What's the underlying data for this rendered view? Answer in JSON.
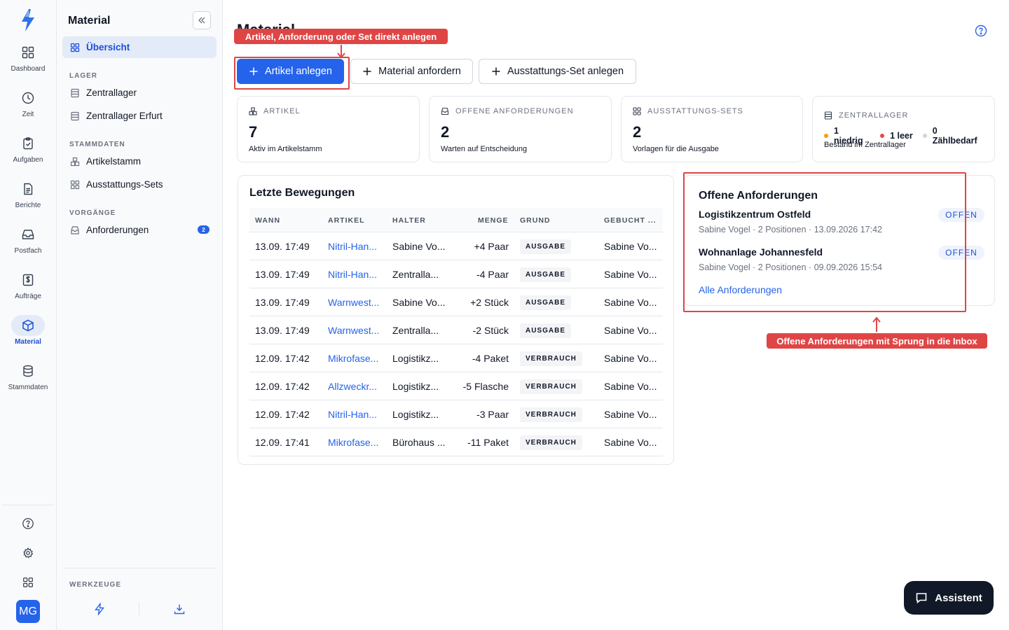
{
  "rail": {
    "items": [
      {
        "label": "Dashboard",
        "icon": "dashboard-icon"
      },
      {
        "label": "Zeit",
        "icon": "clock-icon"
      },
      {
        "label": "Aufgaben",
        "icon": "clipboard-icon"
      },
      {
        "label": "Berichte",
        "icon": "report-icon"
      },
      {
        "label": "Postfach",
        "icon": "inbox-icon"
      },
      {
        "label": "Aufträge",
        "icon": "dollar-document-icon"
      },
      {
        "label": "Material",
        "icon": "box-icon"
      },
      {
        "label": "Stammdaten",
        "icon": "database-icon"
      }
    ],
    "active": "Material",
    "avatar": "MG"
  },
  "nav": {
    "title": "Material",
    "overview": "Übersicht",
    "sections": {
      "lager": "LAGER",
      "stammdaten": "STAMMDATEN",
      "vorgaenge": "VORGÄNGE",
      "werkzeuge": "WERKZEUGE"
    },
    "lager_items": [
      "Zentrallager",
      "Zentrallager Erfurt"
    ],
    "stammdaten_items": [
      "Artikelstamm",
      "Ausstattungs-Sets"
    ],
    "vorgaenge_items": [
      {
        "label": "Anforderungen",
        "badge": "2"
      }
    ]
  },
  "main": {
    "title": "Material",
    "actions": {
      "create_article": "Artikel anlegen",
      "request_material": "Material anfordern",
      "create_set": "Ausstattungs-Set anlegen"
    },
    "kpis": [
      {
        "label": "ARTIKEL",
        "value": "7",
        "sub": "Aktiv im Artikelstamm"
      },
      {
        "label": "OFFENE ANFORDERUNGEN",
        "value": "2",
        "sub": "Warten auf Entscheidung"
      },
      {
        "label": "AUSSTATTUNGS-SETS",
        "value": "2",
        "sub": "Vorlagen für die Ausgabe"
      }
    ],
    "stock": {
      "label": "ZENTRALLAGER",
      "low": "1 niedrig",
      "empty": "1 leer",
      "count": "0 Zählbedarf",
      "sub": "Bestand im Zentrallager"
    },
    "movements": {
      "title": "Letzte Bewegungen",
      "columns": [
        "WANN",
        "ARTIKEL",
        "HALTER",
        "MENGE",
        "GRUND",
        "GEBUCHT ..."
      ],
      "rows": [
        [
          "13.09. 17:49",
          "Nitril-Han...",
          "Sabine Vo...",
          "+4 Paar",
          "AUSGABE",
          "Sabine Vo..."
        ],
        [
          "13.09. 17:49",
          "Nitril-Han...",
          "Zentralla...",
          "-4 Paar",
          "AUSGABE",
          "Sabine Vo..."
        ],
        [
          "13.09. 17:49",
          "Warnwest...",
          "Sabine Vo...",
          "+2 Stück",
          "AUSGABE",
          "Sabine Vo..."
        ],
        [
          "13.09. 17:49",
          "Warnwest...",
          "Zentralla...",
          "-2 Stück",
          "AUSGABE",
          "Sabine Vo..."
        ],
        [
          "12.09. 17:42",
          "Mikrofase...",
          "Logistikz...",
          "-4 Paket",
          "VERBRAUCH",
          "Sabine Vo..."
        ],
        [
          "12.09. 17:42",
          "Allzweckr...",
          "Logistikz...",
          "-5 Flasche",
          "VERBRAUCH",
          "Sabine Vo..."
        ],
        [
          "12.09. 17:42",
          "Nitril-Han...",
          "Logistikz...",
          "-3 Paar",
          "VERBRAUCH",
          "Sabine Vo..."
        ],
        [
          "12.09. 17:41",
          "Mikrofase...",
          "Bürohaus ...",
          "-11 Paket",
          "VERBRAUCH",
          "Sabine Vo..."
        ]
      ]
    },
    "open_requests": {
      "title": "Offene Anforderungen",
      "items": [
        {
          "name": "Logistikzentrum Ostfeld",
          "meta": "Sabine Vogel · 2 Positionen · 13.09.2026 17:42",
          "status": "OFFEN"
        },
        {
          "name": "Wohnanlage Johannesfeld",
          "meta": "Sabine Vogel · 2 Positionen · 09.09.2026 15:54",
          "status": "OFFEN"
        }
      ],
      "all_link": "Alle Anforderungen"
    }
  },
  "annotations": {
    "top": "Artikel, Anforderung oder Set direkt anlegen",
    "right": "Offene Anforderungen mit Sprung in die Inbox"
  },
  "assistant": "Assistent",
  "colors": {
    "primary": "#2563eb",
    "annotation": "#e04545",
    "active_bg": "#e3ebf8",
    "low_dot": "#f59e0b",
    "empty_dot": "#ef4444",
    "count_dot": "#d1d5db"
  }
}
